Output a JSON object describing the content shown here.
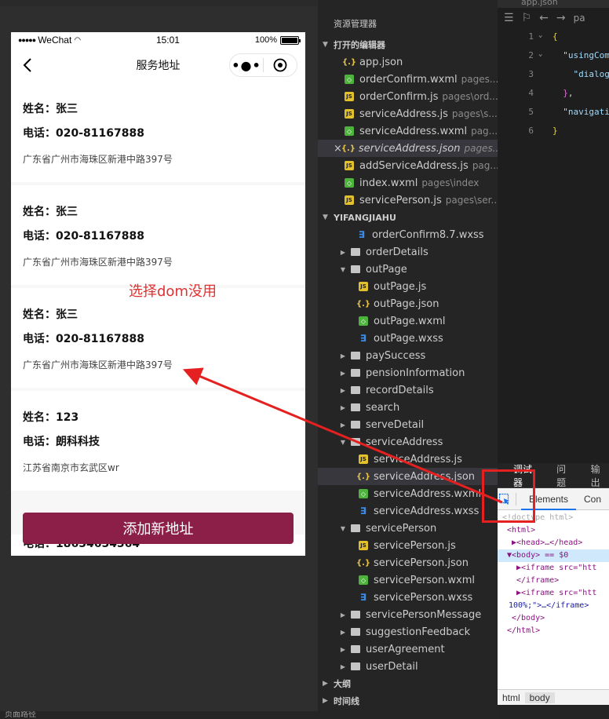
{
  "simulator": {
    "status": {
      "carrier": "WeChat",
      "time": "15:01",
      "battery": "100%",
      "battery_fraction": 1.0
    },
    "nav_title": "服务地址",
    "addresses": [
      {
        "name_label": "姓名：",
        "name": "张三",
        "phone_label": "电话：",
        "phone": "020-81167888",
        "address": "广东省广州市海珠区新港中路397号"
      },
      {
        "name_label": "姓名：",
        "name": "张三",
        "phone_label": "电话：",
        "phone": "020-81167888",
        "address": "广东省广州市海珠区新港中路397号"
      },
      {
        "name_label": "姓名：",
        "name": "张三",
        "phone_label": "电话：",
        "phone": "020-81167888",
        "address": "广东省广州市海珠区新港中路397号"
      },
      {
        "name_label": "姓名：",
        "name": "123",
        "phone_label": "电话：",
        "phone": "朗科科技",
        "address": "江苏省南京市玄武区wr"
      }
    ],
    "partial_row": {
      "phone_label": "电话：",
      "phone": "18654654564"
    },
    "add_button": "添加新地址",
    "annotation": "选择dom没用",
    "bottom_bar": "页面路径"
  },
  "explorer": {
    "header": "资源管理器",
    "open_editors_title": "打开的编辑器",
    "open_editors": [
      {
        "type": "json",
        "name": "app.json",
        "path": ""
      },
      {
        "type": "wxml",
        "name": "orderConfirm.wxml",
        "path": "pages..."
      },
      {
        "type": "js",
        "name": "orderConfirm.js",
        "path": "pages\\ord..."
      },
      {
        "type": "js",
        "name": "serviceAddress.js",
        "path": "pages\\s..."
      },
      {
        "type": "wxml",
        "name": "serviceAddress.wxml",
        "path": "pag..."
      },
      {
        "type": "json",
        "name": "serviceAddress.json",
        "path": "pages...",
        "active": true,
        "close": "×"
      },
      {
        "type": "js",
        "name": "addServiceAddress.js",
        "path": "pag..."
      },
      {
        "type": "wxml",
        "name": "index.wxml",
        "path": "pages\\index"
      },
      {
        "type": "js",
        "name": "servicePerson.js",
        "path": "pages\\ser..."
      }
    ],
    "project_title": "YIFANGJIAHU",
    "tree": [
      {
        "kind": "file",
        "type": "wxss",
        "name": "orderConfirm8.7.wxss",
        "indent": 2
      },
      {
        "kind": "folder",
        "name": "orderDetails",
        "open": false,
        "indent": 1
      },
      {
        "kind": "folder",
        "name": "outPage",
        "open": true,
        "indent": 1
      },
      {
        "kind": "file",
        "type": "js",
        "name": "outPage.js",
        "indent": 2
      },
      {
        "kind": "file",
        "type": "json",
        "name": "outPage.json",
        "indent": 2
      },
      {
        "kind": "file",
        "type": "wxml",
        "name": "outPage.wxml",
        "indent": 2
      },
      {
        "kind": "file",
        "type": "wxss",
        "name": "outPage.wxss",
        "indent": 2
      },
      {
        "kind": "folder",
        "name": "paySuccess",
        "open": false,
        "indent": 1
      },
      {
        "kind": "folder",
        "name": "pensionInformation",
        "open": false,
        "indent": 1
      },
      {
        "kind": "folder",
        "name": "recordDetails",
        "open": false,
        "indent": 1
      },
      {
        "kind": "folder",
        "name": "search",
        "open": false,
        "indent": 1
      },
      {
        "kind": "folder",
        "name": "serveDetail",
        "open": false,
        "indent": 1
      },
      {
        "kind": "folder",
        "name": "serviceAddress",
        "open": true,
        "indent": 1
      },
      {
        "kind": "file",
        "type": "js",
        "name": "serviceAddress.js",
        "indent": 2
      },
      {
        "kind": "file",
        "type": "json",
        "name": "serviceAddress.json",
        "indent": 2,
        "active": true
      },
      {
        "kind": "file",
        "type": "wxml",
        "name": "serviceAddress.wxml",
        "indent": 2
      },
      {
        "kind": "file",
        "type": "wxss",
        "name": "serviceAddress.wxss",
        "indent": 2
      },
      {
        "kind": "folder",
        "name": "servicePerson",
        "open": true,
        "indent": 1
      },
      {
        "kind": "file",
        "type": "js",
        "name": "servicePerson.js",
        "indent": 2
      },
      {
        "kind": "file",
        "type": "json",
        "name": "servicePerson.json",
        "indent": 2
      },
      {
        "kind": "file",
        "type": "wxml",
        "name": "servicePerson.wxml",
        "indent": 2
      },
      {
        "kind": "file",
        "type": "wxss",
        "name": "servicePerson.wxss",
        "indent": 2
      },
      {
        "kind": "folder",
        "name": "servicePersonMessage",
        "open": false,
        "indent": 1
      },
      {
        "kind": "folder",
        "name": "suggestionFeedback",
        "open": false,
        "indent": 1
      },
      {
        "kind": "folder",
        "name": "userAgreement",
        "open": false,
        "indent": 1
      },
      {
        "kind": "folder",
        "name": "userDetail",
        "open": false,
        "indent": 1
      }
    ],
    "outline_title": "大纲",
    "timeline_title": "时间线"
  },
  "editor": {
    "tab": "app.json",
    "toolbar_text": "pa",
    "lines": [
      {
        "n": "1",
        "fold": "⌄",
        "html": "<span class=\"br\">{</span>"
      },
      {
        "n": "2",
        "fold": "⌄",
        "html": "  <span class=\"key\">\"usingCom</span>"
      },
      {
        "n": "3",
        "fold": "",
        "html": "    <span class=\"key\">\"dialog</span>"
      },
      {
        "n": "4",
        "fold": "",
        "html": "  <span class=\"pbr\">}</span>,"
      },
      {
        "n": "5",
        "fold": "",
        "html": "  <span class=\"key\">\"navigati</span>"
      },
      {
        "n": "6",
        "fold": "",
        "html": "<span class=\"br\">}</span>"
      }
    ]
  },
  "devtools": {
    "tabs": [
      "调试器",
      "问题",
      "输出"
    ],
    "elements_tab": "Elements",
    "console_tab": "Con",
    "dom": [
      {
        "kind": "comment",
        "text": "<!doctype html>"
      },
      {
        "kind": "plain",
        "text": "<html>"
      },
      {
        "kind": "plain",
        "text": "▶<head>…</head>"
      },
      {
        "kind": "selected",
        "text": "▼<body> == $0"
      },
      {
        "kind": "iframe",
        "text": "▶<iframe src=\"htt"
      },
      {
        "kind": "plain",
        "text": "</iframe>"
      },
      {
        "kind": "iframe",
        "text": "▶<iframe src=\"htt"
      },
      {
        "kind": "plain",
        "text": "100%;\">…</iframe>"
      },
      {
        "kind": "plain",
        "text": "</body>"
      },
      {
        "kind": "plain",
        "text": "</html>"
      }
    ],
    "crumbs": [
      "html",
      "body"
    ]
  }
}
